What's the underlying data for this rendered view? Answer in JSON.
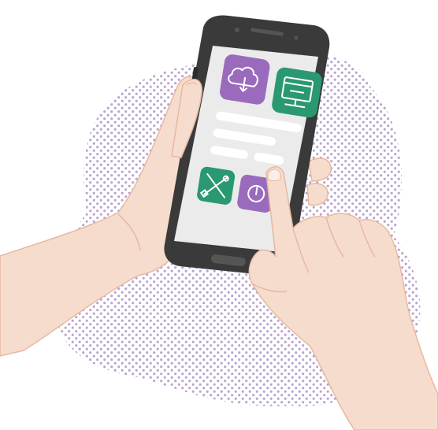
{
  "illustration": {
    "subject": "hands-holding-smartphone",
    "colors": {
      "purple": "#9a6bbd",
      "green": "#2a9870",
      "skin": "#f6dccd",
      "skin_shadow": "#ecc4ae",
      "phone_body": "#3a3a3a",
      "screen": "#ebebeb",
      "dots": "#b9a2cf"
    },
    "screen_tiles": [
      {
        "icon": "cloud-sync-icon",
        "color": "#9a6bbd"
      },
      {
        "icon": "server-window-icon",
        "color": "#2a9870"
      },
      {
        "icon": "tools-icon",
        "color": "#2a9870"
      },
      {
        "icon": "power-icon",
        "color": "#9a6bbd"
      }
    ],
    "placeholder_lines": 4
  }
}
